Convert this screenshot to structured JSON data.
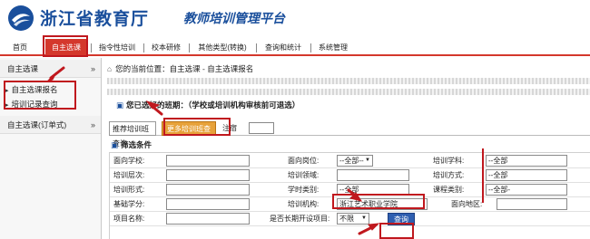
{
  "header": {
    "org_name": "浙江省教育厅",
    "system_name": "教师培训管理平台"
  },
  "nav": {
    "items": [
      {
        "label": "首页"
      },
      {
        "label": "自主选课"
      },
      {
        "label": "指令性培训"
      },
      {
        "label": "校本研修"
      },
      {
        "label": "其他类型(转换)"
      },
      {
        "label": "查询和统计"
      },
      {
        "label": "系统管理"
      }
    ],
    "active_index": 1
  },
  "sidebar": {
    "groups": [
      {
        "label": "自主选课",
        "items": [
          {
            "label": "自主选课报名"
          },
          {
            "label": "培训记录查询"
          }
        ]
      },
      {
        "label": "自主选课(订单式)"
      }
    ]
  },
  "breadcrumb": {
    "text": "您的当前位置：自主选课 - 自主选课报名"
  },
  "selected_section": {
    "title": "您已选好的班期：（学校或培训机构审核前可退选）"
  },
  "tabs": {
    "recommended": "推荐培训班查询",
    "more": "更多培训班查询",
    "suffix": "注宿"
  },
  "filter": {
    "title": "筛选条件",
    "labels": {
      "school": "面向学校:",
      "post": "面向岗位:",
      "subject": "培训学科:",
      "level": "培训层次:",
      "field": "培训领域:",
      "mode": "培训方式:",
      "form": "培训形式:",
      "hour_type": "学时类别:",
      "course_type": "课程类别:",
      "credit": "基础学分:",
      "institution": "培训机构:",
      "region": "面向地区:",
      "project": "项目名称:",
      "long_term": "是否长期开设项目:"
    },
    "values": {
      "post": "--全部--",
      "subject": "--全部",
      "mode": "--全部",
      "hour_type": "--全部",
      "course_type": "--全部-",
      "institution": "浙江艺术职业学院",
      "long_term": "不限"
    },
    "query_button": "查询"
  },
  "colors": {
    "accent_red": "#d4382c",
    "brand_blue": "#1a4f9c",
    "button_orange": "#e7a23a",
    "highlight": "#c0181e"
  }
}
